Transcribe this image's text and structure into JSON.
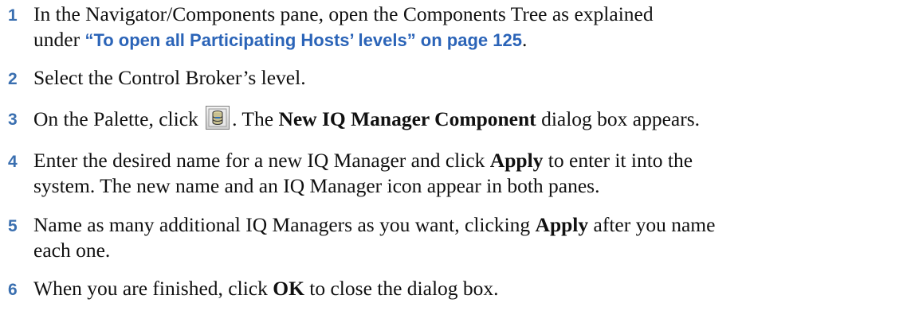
{
  "steps": [
    {
      "number": "1",
      "line1_text": "In the Navigator/Components pane, open the Components Tree as explained",
      "line2_prefix": "under ",
      "line2_link": "“To open all Participating Hosts’ levels” on page 125",
      "line2_suffix": "."
    },
    {
      "number": "2",
      "text": "Select the Control Broker’s level."
    },
    {
      "number": "3",
      "before_icon": "On the Palette, click ",
      "after_icon": ". The ",
      "bold": "New IQ Manager Component",
      "after_bold": " dialog box appears.",
      "icon": "iq-manager-palette-icon"
    },
    {
      "number": "4",
      "line1_before": "Enter the desired name for a new IQ Manager and click ",
      "line1_bold": "Apply",
      "line1_after": " to enter it into the",
      "line2_text": "system. The new name and an IQ Manager icon appear in both panes."
    },
    {
      "number": "5",
      "line1_before": "Name as many additional IQ Managers as you want, clicking ",
      "line1_bold": "Apply",
      "line1_after": " after you name",
      "line2_text": "each one."
    },
    {
      "number": "6",
      "before": "When you are finished, click ",
      "bold": "OK",
      "after": " to close the dialog box."
    }
  ],
  "colors": {
    "step_number": "#3a6fb0",
    "link": "#2b64b8",
    "text": "#111111"
  }
}
